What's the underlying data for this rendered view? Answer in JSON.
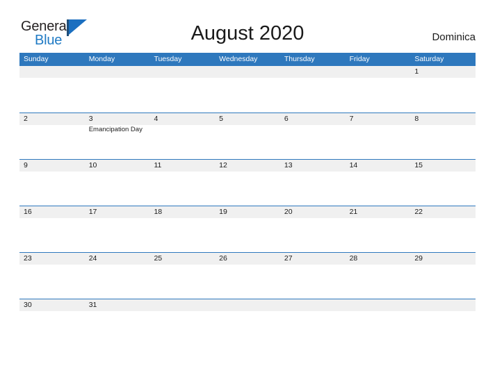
{
  "brand": {
    "name_part1": "General",
    "name_part2": "Blue",
    "flag_icon": "flag-triangle-icon",
    "colors": {
      "dark": "#231f20",
      "blue": "#1f7ac4",
      "flag_blue": "#1b6fc0",
      "flag_bar": "#1f4e79"
    }
  },
  "header": {
    "title": "August 2020",
    "country": "Dominica"
  },
  "calendar": {
    "accent_color": "#2e78bd",
    "band_color": "#f0f0f0",
    "weekdays": [
      "Sunday",
      "Monday",
      "Tuesday",
      "Wednesday",
      "Thursday",
      "Friday",
      "Saturday"
    ],
    "weeks": [
      [
        {
          "day": "",
          "event": ""
        },
        {
          "day": "",
          "event": ""
        },
        {
          "day": "",
          "event": ""
        },
        {
          "day": "",
          "event": ""
        },
        {
          "day": "",
          "event": ""
        },
        {
          "day": "",
          "event": ""
        },
        {
          "day": "1",
          "event": ""
        }
      ],
      [
        {
          "day": "2",
          "event": ""
        },
        {
          "day": "3",
          "event": "Emancipation Day"
        },
        {
          "day": "4",
          "event": ""
        },
        {
          "day": "5",
          "event": ""
        },
        {
          "day": "6",
          "event": ""
        },
        {
          "day": "7",
          "event": ""
        },
        {
          "day": "8",
          "event": ""
        }
      ],
      [
        {
          "day": "9",
          "event": ""
        },
        {
          "day": "10",
          "event": ""
        },
        {
          "day": "11",
          "event": ""
        },
        {
          "day": "12",
          "event": ""
        },
        {
          "day": "13",
          "event": ""
        },
        {
          "day": "14",
          "event": ""
        },
        {
          "day": "15",
          "event": ""
        }
      ],
      [
        {
          "day": "16",
          "event": ""
        },
        {
          "day": "17",
          "event": ""
        },
        {
          "day": "18",
          "event": ""
        },
        {
          "day": "19",
          "event": ""
        },
        {
          "day": "20",
          "event": ""
        },
        {
          "day": "21",
          "event": ""
        },
        {
          "day": "22",
          "event": ""
        }
      ],
      [
        {
          "day": "23",
          "event": ""
        },
        {
          "day": "24",
          "event": ""
        },
        {
          "day": "25",
          "event": ""
        },
        {
          "day": "26",
          "event": ""
        },
        {
          "day": "27",
          "event": ""
        },
        {
          "day": "28",
          "event": ""
        },
        {
          "day": "29",
          "event": ""
        }
      ],
      [
        {
          "day": "30",
          "event": ""
        },
        {
          "day": "31",
          "event": ""
        },
        {
          "day": "",
          "event": ""
        },
        {
          "day": "",
          "event": ""
        },
        {
          "day": "",
          "event": ""
        },
        {
          "day": "",
          "event": ""
        },
        {
          "day": "",
          "event": ""
        }
      ]
    ]
  }
}
